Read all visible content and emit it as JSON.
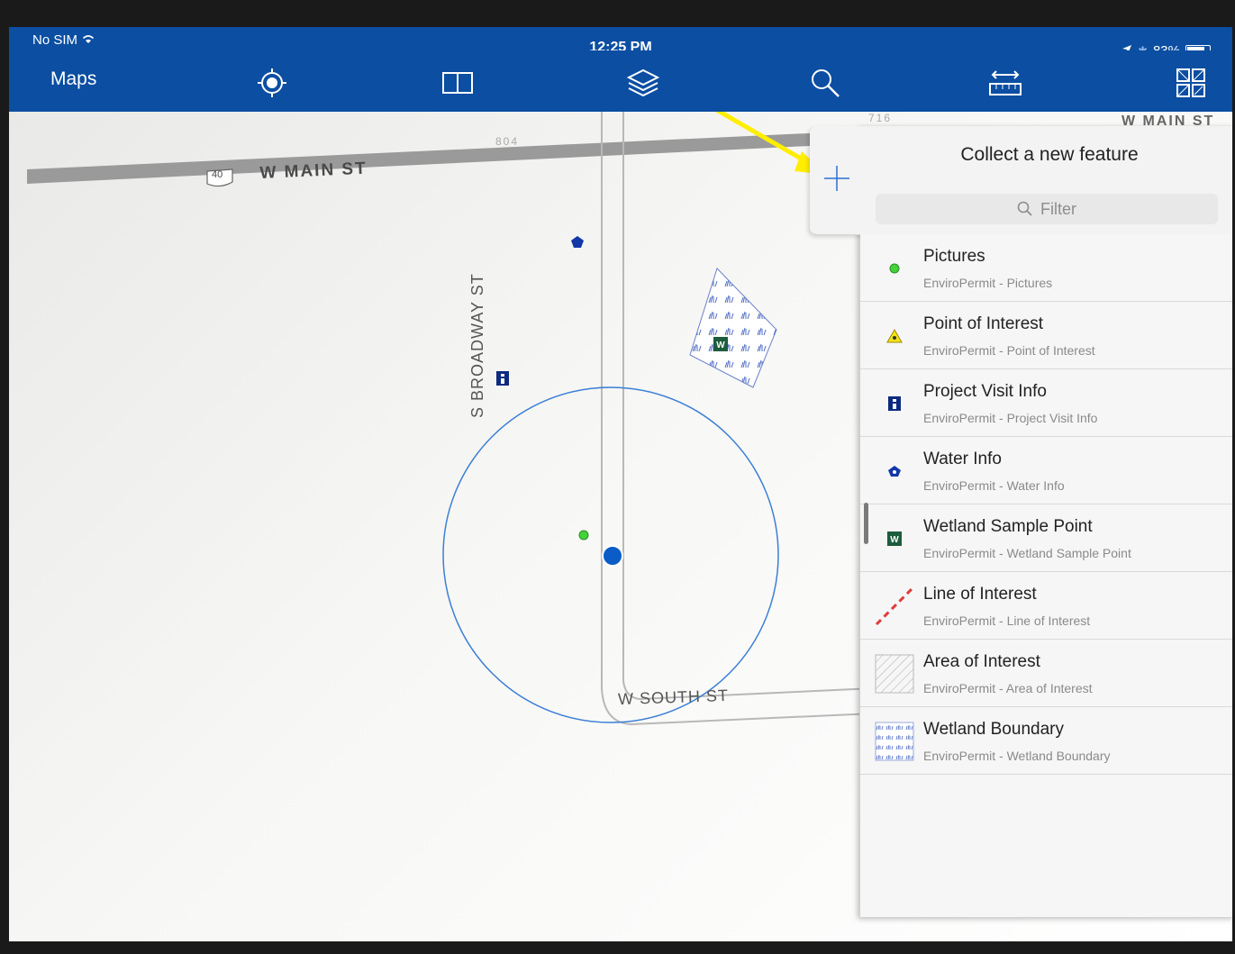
{
  "status_bar": {
    "carrier": "No SIM",
    "time": "12:25 PM",
    "battery": "83%"
  },
  "toolbar": {
    "title": "Maps",
    "icons": [
      "locate-icon",
      "book-icon",
      "layers-icon",
      "search-icon",
      "measure-icon",
      "sketch-icon"
    ]
  },
  "map": {
    "roads": {
      "main": "W MAIN ST",
      "main_right": "W MAIN ST",
      "broadway": "S BROADWAY ST",
      "south": "W SOUTH ST",
      "route_shield": "40"
    },
    "parcels": {
      "p1": "804",
      "p2": "716"
    },
    "colors": {
      "accuracy_circle": "#3b7fd6",
      "location_dot": "#0a5cc7",
      "picture_point": "#44d13b",
      "highlight_arrow": "#ffee00"
    }
  },
  "panel": {
    "title": "Collect a new feature",
    "filter_placeholder": "Filter",
    "features": [
      {
        "name": "Pictures",
        "desc": "EnviroPermit - Pictures",
        "symbol": "green-dot-icon"
      },
      {
        "name": "Point of Interest",
        "desc": "EnviroPermit - Point of Interest",
        "symbol": "yellow-triangle-icon"
      },
      {
        "name": "Project Visit Info",
        "desc": "EnviroPermit - Project Visit Info",
        "symbol": "info-square-icon"
      },
      {
        "name": "Water Info",
        "desc": "EnviroPermit - Water Info",
        "symbol": "blue-pentagon-icon"
      },
      {
        "name": "Wetland Sample Point",
        "desc": "EnviroPermit - Wetland Sample Point",
        "symbol": "wetland-w-icon"
      },
      {
        "name": "Line of Interest",
        "desc": "EnviroPermit - Line of Interest",
        "symbol": "dashed-red-line-icon"
      },
      {
        "name": "Area of Interest",
        "desc": "EnviroPermit - Area of Interest",
        "symbol": "hatched-area-icon"
      },
      {
        "name": "Wetland Boundary",
        "desc": "EnviroPermit - Wetland Boundary",
        "symbol": "wetland-pattern-icon"
      }
    ]
  }
}
